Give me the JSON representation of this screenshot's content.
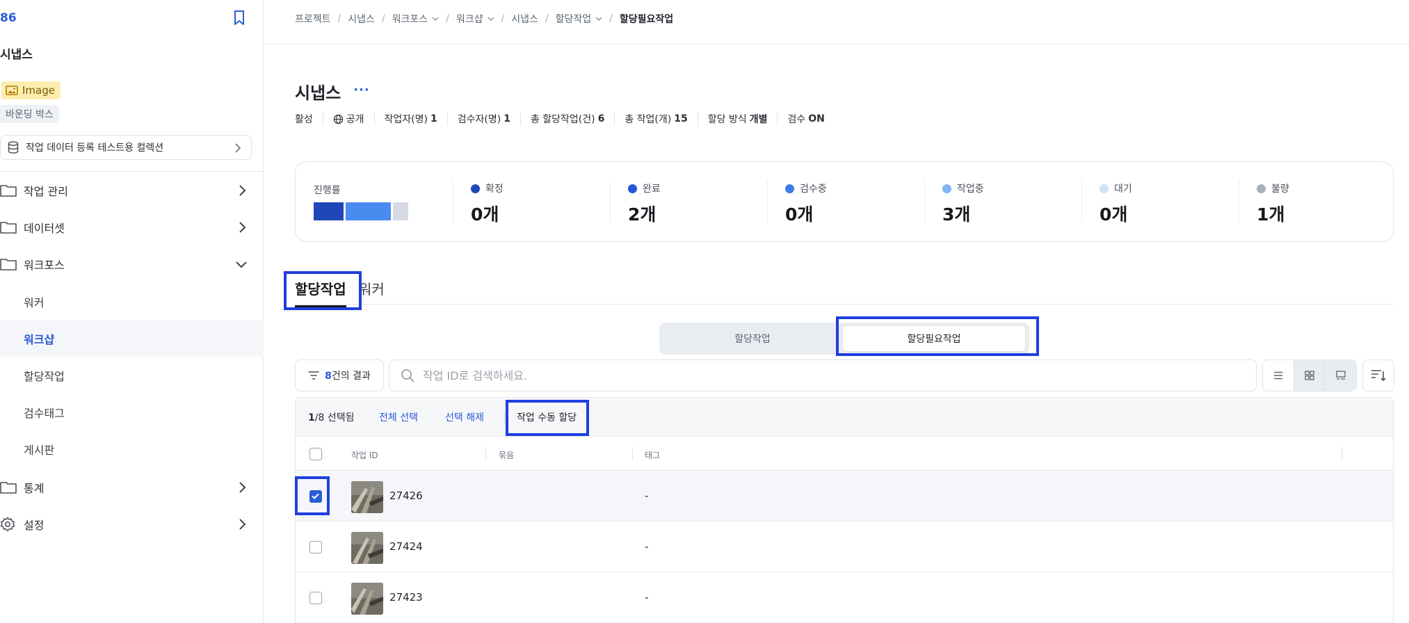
{
  "sidebar": {
    "project_id": "86",
    "project_title": "시냅스",
    "badge_image": "Image",
    "badge_bbox": "바운딩 박스",
    "collection": "작업 데이터 등록 테스트용 컬렉션",
    "nav": [
      {
        "label": "작업 관리"
      },
      {
        "label": "데이터셋"
      },
      {
        "label": "워크포스"
      }
    ],
    "sub": [
      {
        "label": "워커"
      },
      {
        "label": "워크샵"
      },
      {
        "label": "할당작업"
      },
      {
        "label": "검수태그"
      },
      {
        "label": "게시판"
      }
    ],
    "nav_bottom": [
      {
        "label": "통계"
      },
      {
        "label": "설정"
      }
    ]
  },
  "breadcrumb": {
    "items": [
      "프로젝트",
      "시냅스",
      "워크포스",
      "워크샵",
      "시냅스",
      "할당작업",
      "할당필요작업"
    ]
  },
  "page": {
    "title": "시냅스",
    "more": "···",
    "meta": {
      "status": "활성",
      "visibility": "공개",
      "workers_label": "작업자(명)",
      "workers_value": "1",
      "reviewers_label": "검수자(명)",
      "reviewers_value": "1",
      "assigned_label": "총 할당작업(건)",
      "assigned_value": "6",
      "total_label": "총 작업(개)",
      "total_value": "15",
      "method_label": "할당 방식",
      "method_value": "개별",
      "review_label": "검수",
      "review_value": "ON"
    }
  },
  "progress": {
    "label": "진행률",
    "bar_segments": [
      {
        "color": "#1f47b8",
        "share": 0.25
      },
      {
        "color": "#4a8bef",
        "share": 0.375
      },
      {
        "color": "#d6dbe3",
        "share": 0.125
      }
    ],
    "stats": [
      {
        "label": "확정",
        "value": "0개",
        "color": "#1f47b8"
      },
      {
        "label": "완료",
        "value": "2개",
        "color": "#2458d6"
      },
      {
        "label": "검수중",
        "value": "0개",
        "color": "#3d7be5"
      },
      {
        "label": "작업중",
        "value": "3개",
        "color": "#82b3f2"
      },
      {
        "label": "대기",
        "value": "0개",
        "color": "#cfe0f7"
      },
      {
        "label": "불량",
        "value": "1개",
        "color": "#a9b0ba"
      }
    ]
  },
  "tabs": {
    "active": "할당작업",
    "inactive": "워커"
  },
  "segment": {
    "left": "할당작업",
    "right": "할당필요작업"
  },
  "toolbar": {
    "result_count": "8",
    "result_suffix": "건의 결과",
    "search_placeholder": "작업 ID로 검색하세요."
  },
  "table": {
    "selected_count": "1",
    "total_count": "/8",
    "selected_suffix": "선택됨",
    "select_all": "전체 선택",
    "deselect": "선택 해제",
    "manual_assign": "작업 수동 할당",
    "columns": [
      "작업 ID",
      "묶음",
      "태그"
    ],
    "rows": [
      {
        "id": "27426",
        "tag": "-",
        "checked": true
      },
      {
        "id": "27424",
        "tag": "-",
        "checked": false
      },
      {
        "id": "27423",
        "tag": "-",
        "checked": false
      }
    ]
  },
  "colors": {
    "accent": "#2a5bd7",
    "highlight": "#1f3fe0"
  }
}
